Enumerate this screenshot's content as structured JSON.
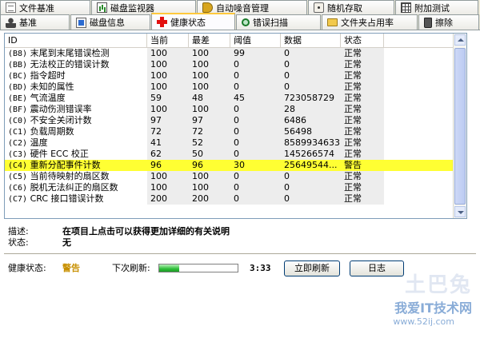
{
  "tabs_row1": [
    {
      "icon": "document-icon",
      "label": "文件基准"
    },
    {
      "icon": "chart-icon",
      "label": "磁盘监视器"
    },
    {
      "icon": "speaker-icon",
      "label": "自动噪音管理"
    },
    {
      "icon": "dice-icon",
      "label": "随机存取"
    },
    {
      "icon": "grid-icon",
      "label": "附加测试"
    }
  ],
  "tabs_row2": [
    {
      "icon": "person-icon",
      "label": "基准"
    },
    {
      "icon": "info-icon",
      "label": "磁盘信息"
    },
    {
      "icon": "health-cross-icon",
      "label": "健康状态"
    },
    {
      "icon": "magnifier-icon",
      "label": "错误扫描"
    },
    {
      "icon": "folder-icon",
      "label": "文件夹占用率"
    },
    {
      "icon": "trash-icon",
      "label": "擦除"
    }
  ],
  "active_tab": "健康状态",
  "table": {
    "columns": [
      "ID",
      "当前",
      "最差",
      "阈值",
      "数据",
      "状态"
    ],
    "rows": [
      {
        "code": "(B8)",
        "name": "末尾到末尾错误检测",
        "current": "100",
        "worst": "100",
        "threshold": "99",
        "data": "0",
        "status": "正常"
      },
      {
        "code": "(BB)",
        "name": "无法校正的错误计数",
        "current": "100",
        "worst": "100",
        "threshold": "0",
        "data": "0",
        "status": "正常"
      },
      {
        "code": "(BC)",
        "name": "指令超时",
        "current": "100",
        "worst": "100",
        "threshold": "0",
        "data": "0",
        "status": "正常"
      },
      {
        "code": "(BD)",
        "name": "未知的属性",
        "current": "100",
        "worst": "100",
        "threshold": "0",
        "data": "0",
        "status": "正常"
      },
      {
        "code": "(BE)",
        "name": "气流温度",
        "current": "59",
        "worst": "48",
        "threshold": "45",
        "data": "723058729",
        "status": "正常"
      },
      {
        "code": "(BF)",
        "name": "震动伤测错误率",
        "current": "100",
        "worst": "100",
        "threshold": "0",
        "data": "28",
        "status": "正常"
      },
      {
        "code": "(C0)",
        "name": "不安全关闭计数",
        "current": "97",
        "worst": "97",
        "threshold": "0",
        "data": "6486",
        "status": "正常"
      },
      {
        "code": "(C1)",
        "name": "负载周期数",
        "current": "72",
        "worst": "72",
        "threshold": "0",
        "data": "56498",
        "status": "正常"
      },
      {
        "code": "(C2)",
        "name": "温度",
        "current": "41",
        "worst": "52",
        "threshold": "0",
        "data": "8589934633",
        "status": "正常"
      },
      {
        "code": "(C3)",
        "name": "硬件 ECC 校正",
        "current": "62",
        "worst": "50",
        "threshold": "0",
        "data": "145266574",
        "status": "正常"
      },
      {
        "code": "(C4)",
        "name": "重新分配事件计数",
        "current": "96",
        "worst": "96",
        "threshold": "30",
        "data": "25649544...",
        "status": "警告",
        "highlight": true
      },
      {
        "code": "(C5)",
        "name": "当前待映射的扇区数",
        "current": "100",
        "worst": "100",
        "threshold": "0",
        "data": "0",
        "status": "正常"
      },
      {
        "code": "(C6)",
        "name": "脱机无法纠正的扇区数",
        "current": "100",
        "worst": "100",
        "threshold": "0",
        "data": "0",
        "status": "正常"
      },
      {
        "code": "(C7)",
        "name": "CRC 接口错误计数",
        "current": "200",
        "worst": "200",
        "threshold": "0",
        "data": "0",
        "status": "正常"
      }
    ]
  },
  "description": {
    "desc_label": "描述:",
    "desc_value": "在项目上点击可以获得更加详细的有关说明",
    "status_label": "状态:",
    "status_value": "无"
  },
  "status_bar": {
    "health_label": "健康状态:",
    "health_value": "警告",
    "health_color": "#c89000",
    "next_refresh_label": "下次刷新:",
    "refresh_progress": 0.25,
    "timer": "3:33",
    "refresh_now_button": "立即刷新",
    "log_button": "日志"
  },
  "watermark": {
    "line1": "土巴兔",
    "line2": "我爱IT技术网",
    "line3": "www.52ij.com"
  },
  "colors": {
    "highlight_row": "#ffff33",
    "tab_active_border": "#ffc83c"
  }
}
